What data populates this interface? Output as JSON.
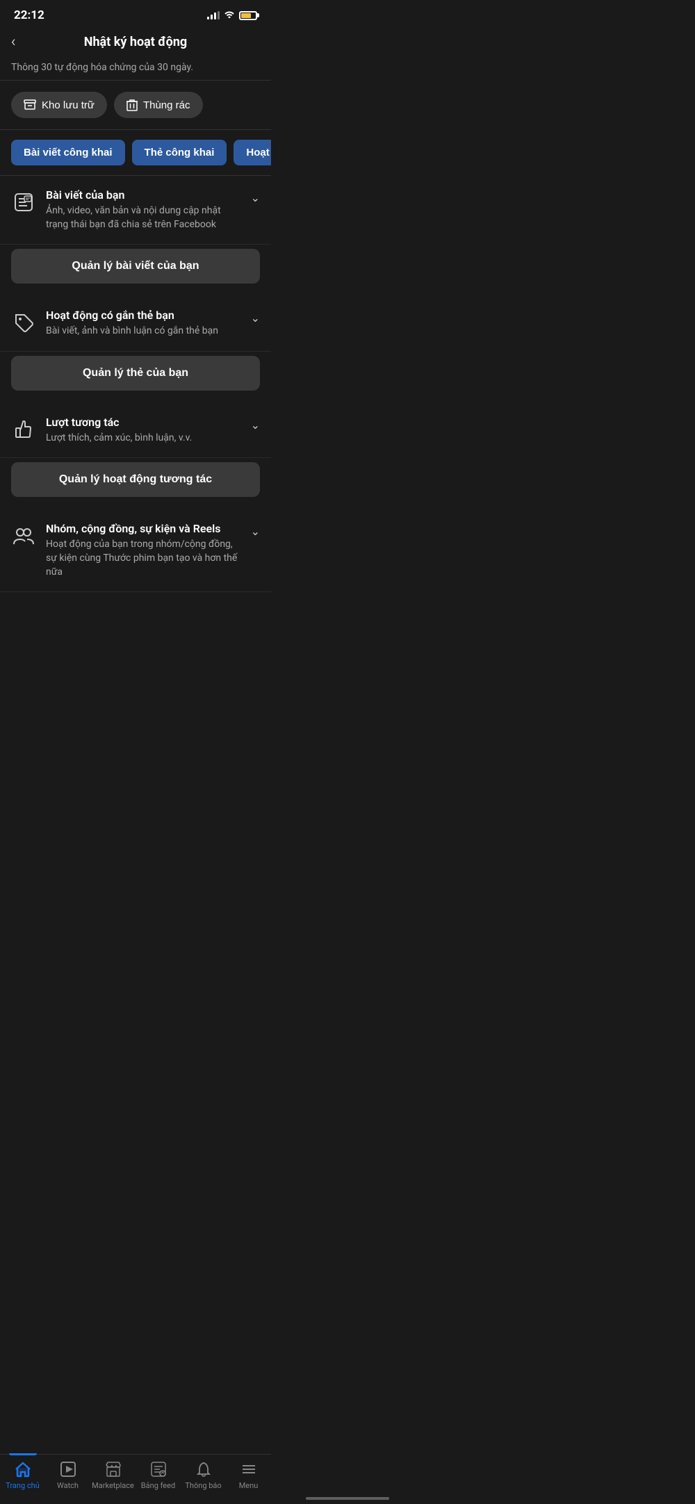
{
  "statusBar": {
    "time": "22:12"
  },
  "header": {
    "backLabel": "‹",
    "title": "Nhật ký hoạt động"
  },
  "subtitleText": "Thông 30 tự động hóa chứng của 30 ngày.",
  "actionButtons": [
    {
      "id": "archive",
      "label": "Kho lưu trữ",
      "iconType": "archive"
    },
    {
      "id": "trash",
      "label": "Thùng rác",
      "iconType": "trash"
    }
  ],
  "filterTabs": [
    {
      "id": "public-posts",
      "label": "Bài viết công khai"
    },
    {
      "id": "public-tags",
      "label": "Thẻ công khai"
    },
    {
      "id": "activity",
      "label": "Hoạt động trẻ"
    }
  ],
  "sections": [
    {
      "id": "your-posts",
      "iconType": "posts",
      "title": "Bài viết của bạn",
      "desc": "Ảnh, video, văn bản và nội dung cập nhật trạng thái bạn đã chia sẻ trên Facebook",
      "manageLabel": "Quản lý bài viết của bạn"
    },
    {
      "id": "tagged-activity",
      "iconType": "tag",
      "title": "Hoạt động có gắn thẻ bạn",
      "desc": "Bài viết, ảnh và bình luận có gắn thẻ bạn",
      "manageLabel": "Quản lý thẻ của bạn"
    },
    {
      "id": "interactions",
      "iconType": "thumbsup",
      "title": "Lượt tương tác",
      "desc": "Lượt thích, cảm xúc, bình luận, v.v.",
      "manageLabel": "Quản lý hoạt động tương tác"
    },
    {
      "id": "groups-reels",
      "iconType": "groups",
      "title": "Nhóm, cộng đồng, sự kiện và Reels",
      "desc": "Hoạt động của bạn trong nhóm/cộng đồng, sự kiện cùng Thước phim bạn tạo và hơn thế nữa",
      "manageLabel": null
    }
  ],
  "bottomNav": [
    {
      "id": "home",
      "label": "Trang chủ",
      "iconType": "home",
      "active": true
    },
    {
      "id": "watch",
      "label": "Watch",
      "iconType": "watch",
      "active": false
    },
    {
      "id": "marketplace",
      "label": "Marketplace",
      "iconType": "marketplace",
      "active": false
    },
    {
      "id": "feed",
      "label": "Bảng feed",
      "iconType": "feed",
      "active": false
    },
    {
      "id": "notifications",
      "label": "Thông báo",
      "iconType": "bell",
      "active": false
    },
    {
      "id": "menu",
      "label": "Menu",
      "iconType": "menu",
      "active": false
    }
  ]
}
